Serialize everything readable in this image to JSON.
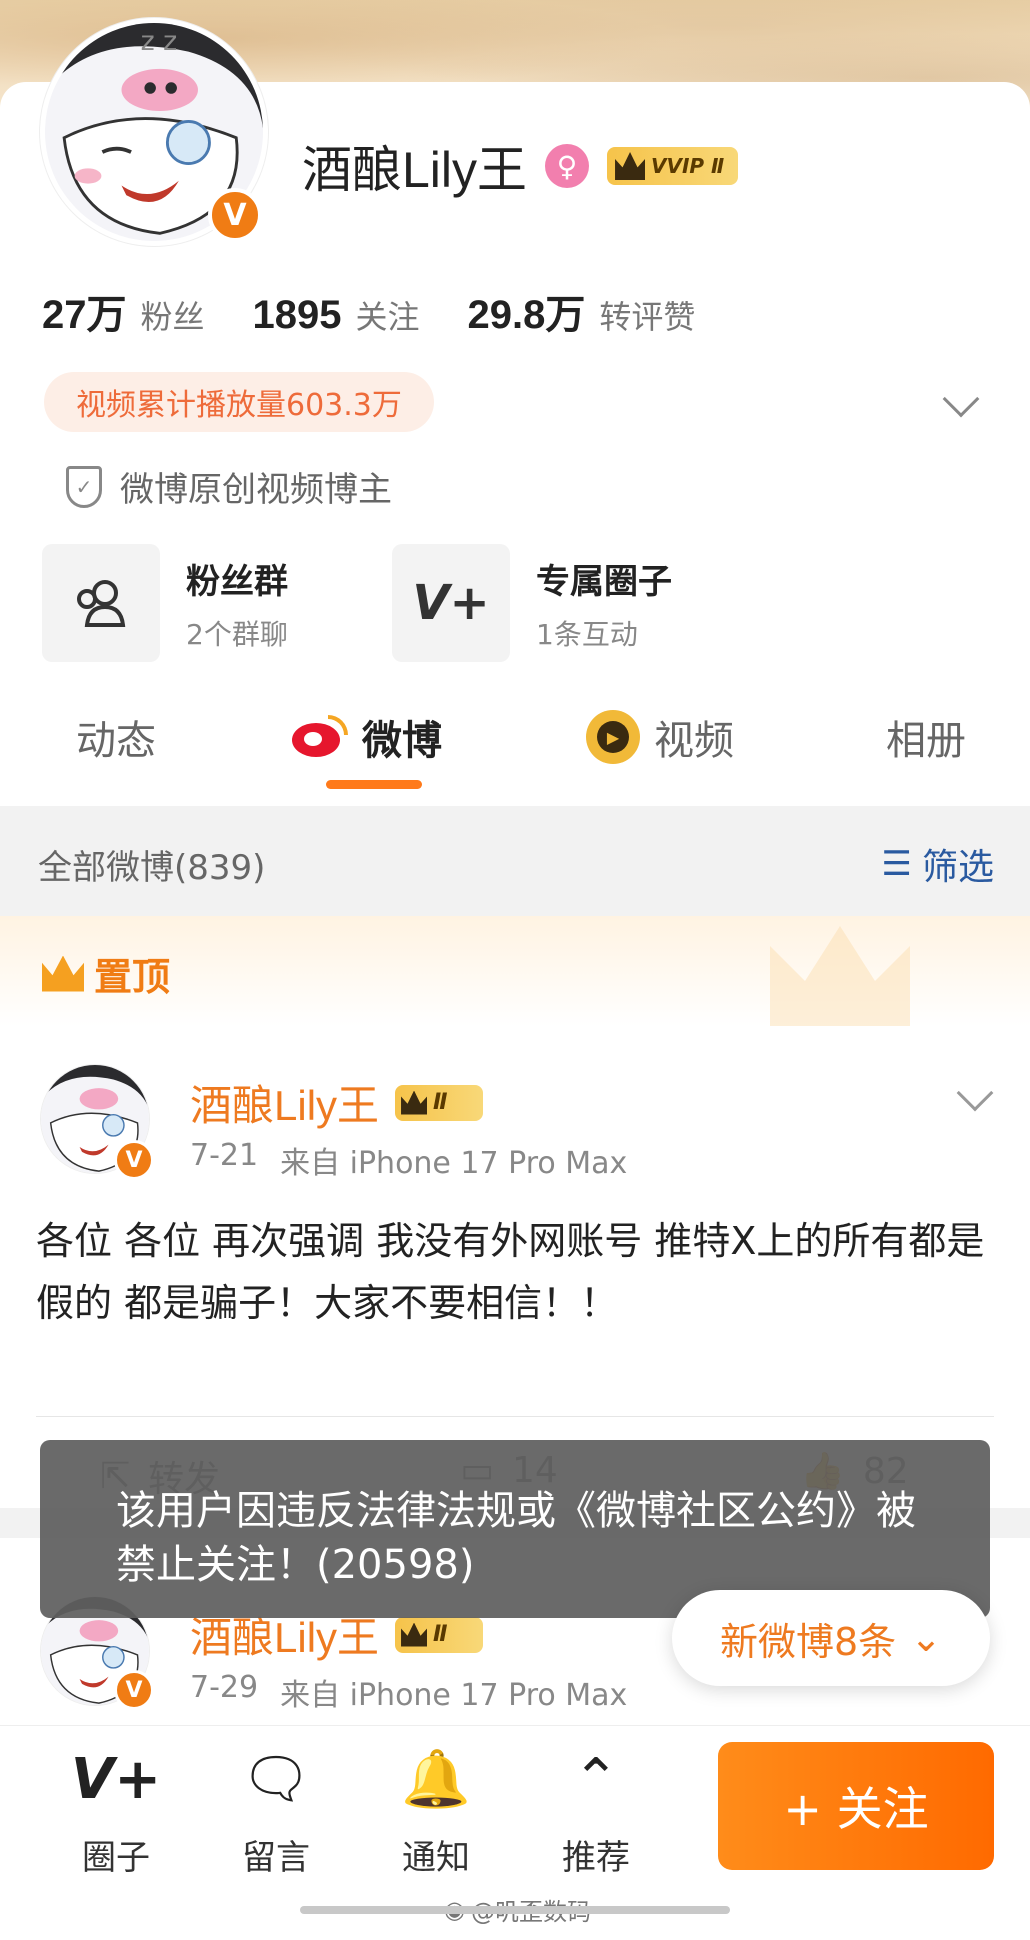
{
  "profile": {
    "name": "酒酿Lily王",
    "gender_symbol": "♀",
    "vip_label": "VVIP Ⅱ",
    "verified_symbol": "V"
  },
  "stats": [
    {
      "num": "27万",
      "label": "粉丝"
    },
    {
      "num": "1895",
      "label": "关注"
    },
    {
      "num": "29.8万",
      "label": "转评赞"
    }
  ],
  "video_plays": "视频累计播放量603.3万",
  "creator_badge": "微博原创视频博主",
  "tiles": [
    {
      "title": "粉丝群",
      "sub": "2个群聊"
    },
    {
      "title": "专属圈子",
      "sub": "1条互动"
    }
  ],
  "tabs": [
    "动态",
    "微博",
    "视频",
    "相册"
  ],
  "filter": {
    "left": "全部微博(839)",
    "right": "筛选"
  },
  "pinned_label": "置顶",
  "posts": [
    {
      "name": "酒酿Lily王",
      "vip": "Ⅱ",
      "date": "7-21",
      "source": "来自 iPhone 17 Pro Max",
      "text": "各位 各位 再次强调 我没有外网账号 推特X上的所有都是假的 都是骗子！大家不要相信！！"
    },
    {
      "name": "酒酿Lily王",
      "vip": "Ⅱ",
      "date": "7-29",
      "source": "来自 iPhone 17 Pro Max"
    }
  ],
  "actions": {
    "repost": "转发",
    "comments": "14",
    "likes": "82"
  },
  "toast": "该用户因违反法律法规或《微博社区公约》被禁止关注！(20598)",
  "new_posts": "新微博8条",
  "bottom_nav": [
    "圈子",
    "留言",
    "通知",
    "推荐"
  ],
  "follow_button": "+ 关注",
  "watermark": "@叽歪数码",
  "colors": {
    "accent": "#ff7a1a",
    "link_blue": "#2a5aa0",
    "name_orange": "#ee7a20"
  }
}
